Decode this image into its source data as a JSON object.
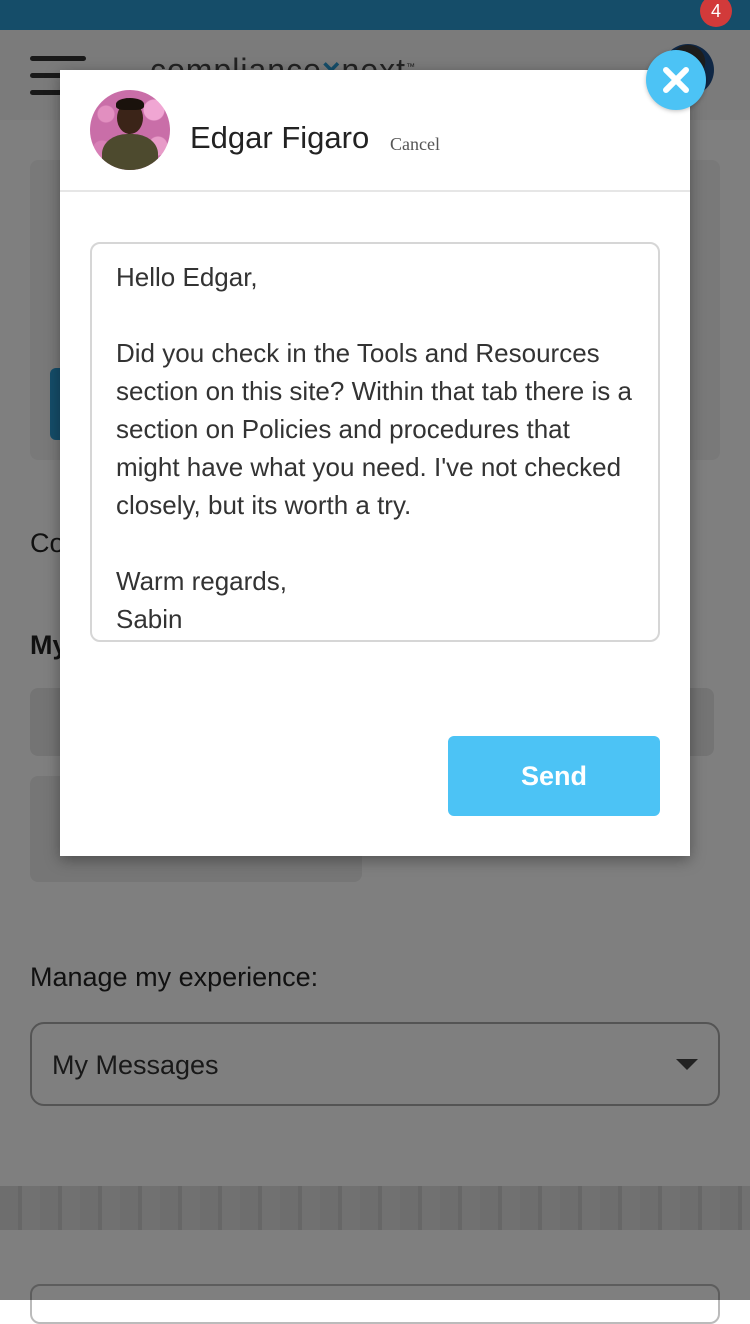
{
  "header": {
    "logo_text": "compliance",
    "logo_text_2": "next",
    "logo_tm": "™",
    "notification_count": "4"
  },
  "background": {
    "partial_text_1": "Co",
    "partial_text_2": "My",
    "manage_label": "Manage my experience:",
    "manage_select_value": "My Messages"
  },
  "modal": {
    "contact_name": "Edgar Figaro",
    "cancel_label": "Cancel",
    "message_body": "Hello Edgar,\n\nDid you check in the Tools and Resources section on this site? Within that tab there is a section on Policies and procedures that might have what you need. I've not checked closely, but its worth a try.\n\nWarm regards,\nSabin",
    "send_label": "Send"
  },
  "colors": {
    "accent": "#4cc3f5",
    "brand_blue": "#2b9ad2",
    "badge_red": "#d23a3a"
  }
}
